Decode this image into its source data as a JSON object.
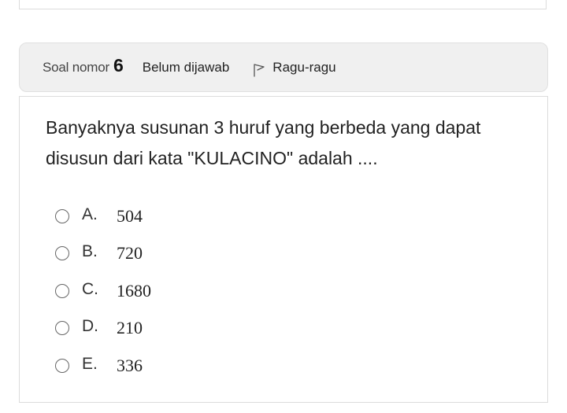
{
  "header": {
    "question_label": "Soal nomor",
    "question_number": "6",
    "status": "Belum dijawab",
    "flag_label": "Ragu-ragu"
  },
  "question": {
    "text_line1": "Banyaknya susunan 3 huruf yang berbeda yang dapat",
    "text_line2": "disusun dari kata \"KULACINO\" adalah ...."
  },
  "options": [
    {
      "letter": "A.",
      "value": "504"
    },
    {
      "letter": "B.",
      "value": "720"
    },
    {
      "letter": "C.",
      "value": "1680"
    },
    {
      "letter": "D.",
      "value": "210"
    },
    {
      "letter": "E.",
      "value": "336"
    }
  ]
}
